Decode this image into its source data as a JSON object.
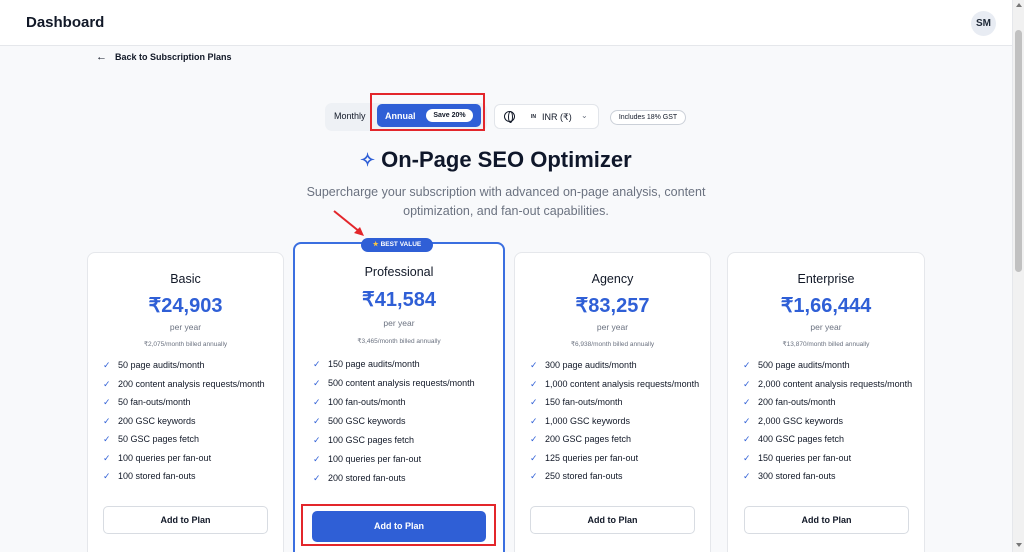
{
  "header": {
    "title": "Dashboard",
    "avatar_initials": "SM"
  },
  "nav": {
    "back_label": "Back to Subscription Plans"
  },
  "billing": {
    "monthly_label": "Monthly",
    "annual_label": "Annual",
    "save_badge": "Save 20%",
    "currency_flag": "IN",
    "currency": "INR (₹)",
    "gst_note": "Includes 18% GST"
  },
  "hero": {
    "title": "On-Page SEO Optimizer",
    "subtitle": "Supercharge your subscription with advanced on-page analysis, content optimization, and fan-out capabilities."
  },
  "best_value_badge": "BEST VALUE",
  "plans": [
    {
      "name": "Basic",
      "price": "₹24,903",
      "period": "per year",
      "billed": "₹2,075/month billed annually",
      "features": [
        "50 page audits/month",
        "200 content analysis requests/month",
        "50 fan-outs/month",
        "200 GSC keywords",
        "50 GSC pages fetch",
        "100 queries per fan-out",
        "100 stored fan-outs"
      ],
      "button": "Add to Plan"
    },
    {
      "name": "Professional",
      "price": "₹41,584",
      "period": "per year",
      "billed": "₹3,465/month billed annually",
      "features": [
        "150 page audits/month",
        "500 content analysis requests/month",
        "100 fan-outs/month",
        "500 GSC keywords",
        "100 GSC pages fetch",
        "100 queries per fan-out",
        "200 stored fan-outs"
      ],
      "button": "Add to Plan"
    },
    {
      "name": "Agency",
      "price": "₹83,257",
      "period": "per year",
      "billed": "₹6,938/month billed annually",
      "features": [
        "300 page audits/month",
        "1,000 content analysis requests/month",
        "150 fan-outs/month",
        "1,000 GSC keywords",
        "200 GSC pages fetch",
        "125 queries per fan-out",
        "250 stored fan-outs"
      ],
      "button": "Add to Plan"
    },
    {
      "name": "Enterprise",
      "price": "₹1,66,444",
      "period": "per year",
      "billed": "₹13,870/month billed annually",
      "features": [
        "500 page audits/month",
        "2,000 content analysis requests/month",
        "200 fan-outs/month",
        "2,000 GSC keywords",
        "400 GSC pages fetch",
        "150 queries per fan-out",
        "300 stored fan-outs"
      ],
      "button": "Add to Plan"
    }
  ],
  "colors": {
    "accent": "#2f5fd6",
    "highlight": "#e3262b"
  }
}
